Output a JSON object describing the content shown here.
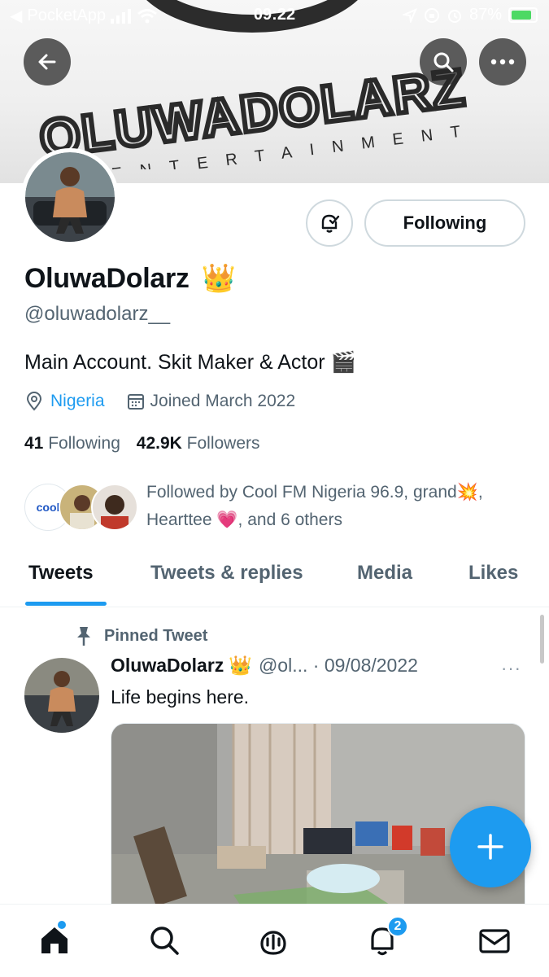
{
  "status_bar": {
    "carrier": "PocketApp",
    "time": "09:22",
    "battery": "87%",
    "battery_level": 0.87
  },
  "banner": {
    "brand": "OLUWADOLARZ",
    "tagline": "ENTERTAINMENT"
  },
  "profile": {
    "display_name": "OluwaDolarz",
    "name_emoji": "👑",
    "handle": "@oluwadolarz__",
    "bio": "Main Account. Skit Maker & Actor",
    "bio_emoji": "🎬",
    "location": "Nigeria",
    "joined": "Joined March 2022",
    "following_count": "41",
    "following_label": "Following",
    "followers_count": "42.9K",
    "followers_label": "Followers",
    "follow_button": "Following",
    "followed_by": "Followed by Cool FM Nigeria 96.9, grand",
    "followed_by_emoji1": "💥",
    "followed_by_mid": ",",
    "followed_by_line2": "Hearttee",
    "followed_by_emoji2": "💗",
    "followed_by_end": ", and 6 others",
    "cool_logo": "cool"
  },
  "tabs": [
    {
      "label": "Tweets",
      "active": true
    },
    {
      "label": "Tweets & replies",
      "active": false
    },
    {
      "label": "Media",
      "active": false
    },
    {
      "label": "Likes",
      "active": false
    }
  ],
  "tweet": {
    "pinned_label": "Pinned Tweet",
    "name": "OluwaDolarz",
    "name_emoji": "👑",
    "handle_date": "@ol... · 09/08/2022",
    "text": "Life begins here.",
    "more": "···"
  },
  "bottom_nav": {
    "items": [
      "home-icon",
      "search-icon",
      "spaces-icon",
      "notifications-icon",
      "messages-icon"
    ],
    "notifications_badge": "2"
  },
  "colors": {
    "accent": "#1d9bf0",
    "text": "#0f1419",
    "secondary": "#536471"
  }
}
